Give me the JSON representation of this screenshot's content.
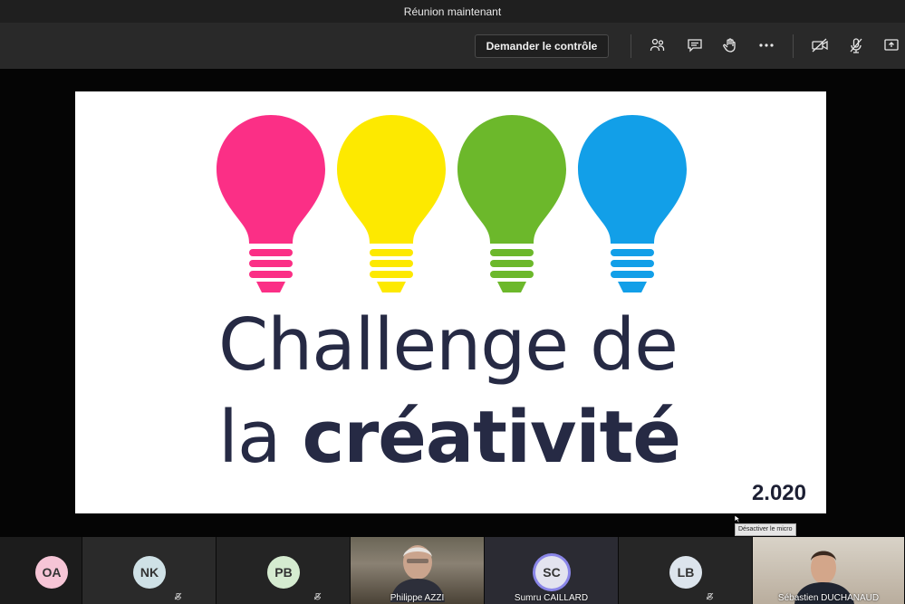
{
  "titlebar": {
    "title": "Réunion maintenant"
  },
  "toolbar": {
    "request_control_label": "Demander le contrôle",
    "icons": [
      "participants-icon",
      "chat-icon",
      "raise-hand-icon",
      "more-options-icon",
      "camera-off-icon",
      "mic-off-icon",
      "share-tray-icon"
    ]
  },
  "slide": {
    "title_line1": "Challenge de",
    "title_line2_regular": "la ",
    "title_line2_bold": "créativité",
    "year": "2.020",
    "bulb_colors": [
      "#fb2f86",
      "#fde900",
      "#6cb82b",
      "#129fe8"
    ]
  },
  "tooltip": {
    "text": "Désactiver le micro"
  },
  "participants": [
    {
      "initials": "OA",
      "name": "",
      "avatar_color": "#f6c5d6"
    },
    {
      "initials": "NK",
      "name": "",
      "avatar_color": "#cfe1e6"
    },
    {
      "initials": "PB",
      "name": "",
      "avatar_color": "#d5ebd0"
    },
    {
      "initials": "",
      "name": "Philippe AZZI",
      "avatar_color": "#c7b8a5"
    },
    {
      "initials": "SC",
      "name": "Sumru CAILLARD",
      "avatar_color": "#e3e3ef"
    },
    {
      "initials": "LB",
      "name": "",
      "avatar_color": "#dce4ec"
    },
    {
      "initials": "",
      "name": "Sébastien DUCHANAUD",
      "avatar_color": "#d6c7b7"
    }
  ]
}
